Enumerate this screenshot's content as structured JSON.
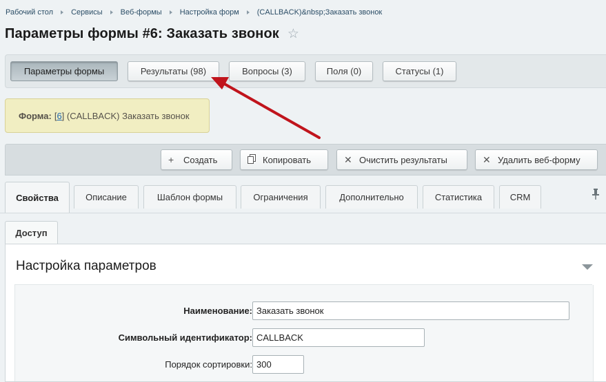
{
  "breadcrumb": [
    "Рабочий стол",
    "Сервисы",
    "Веб-формы",
    "Настройка форм",
    "(CALLBACK)&nbsp;Заказать звонок"
  ],
  "page_title": "Параметры формы #6: Заказать звонок",
  "top_tabs": [
    {
      "label": "Параметры формы",
      "active": true
    },
    {
      "label": "Результаты (98)",
      "active": false
    },
    {
      "label": "Вопросы (3)",
      "active": false
    },
    {
      "label": "Поля (0)",
      "active": false
    },
    {
      "label": "Статусы (1)",
      "active": false
    }
  ],
  "form_note": {
    "label": "Форма:",
    "id_link": "6",
    "text": "(CALLBACK) Заказать звонок"
  },
  "actions": [
    {
      "label": "Создать",
      "icon": "plus-icon"
    },
    {
      "label": "Копировать",
      "icon": "copy-icon"
    },
    {
      "label": "Очистить результаты",
      "icon": "clear-icon"
    },
    {
      "label": "Удалить веб-форму",
      "icon": "delete-icon"
    }
  ],
  "tabs": [
    "Свойства",
    "Описание",
    "Шаблон формы",
    "Ограничения",
    "Дополнительно",
    "Статистика",
    "CRM"
  ],
  "tabs_row2": [
    "Доступ"
  ],
  "section": {
    "title": "Настройка параметров"
  },
  "fields": [
    {
      "label": "Наименование:",
      "value": "Заказать звонок"
    },
    {
      "label": "Символьный идентификатор:",
      "value": "CALLBACK"
    },
    {
      "label": "Порядок сортировки:",
      "value": "300"
    }
  ],
  "colors": {
    "arrow": "#c0141c",
    "accent": "#2067b0",
    "note_bg": "#f1eec2"
  }
}
